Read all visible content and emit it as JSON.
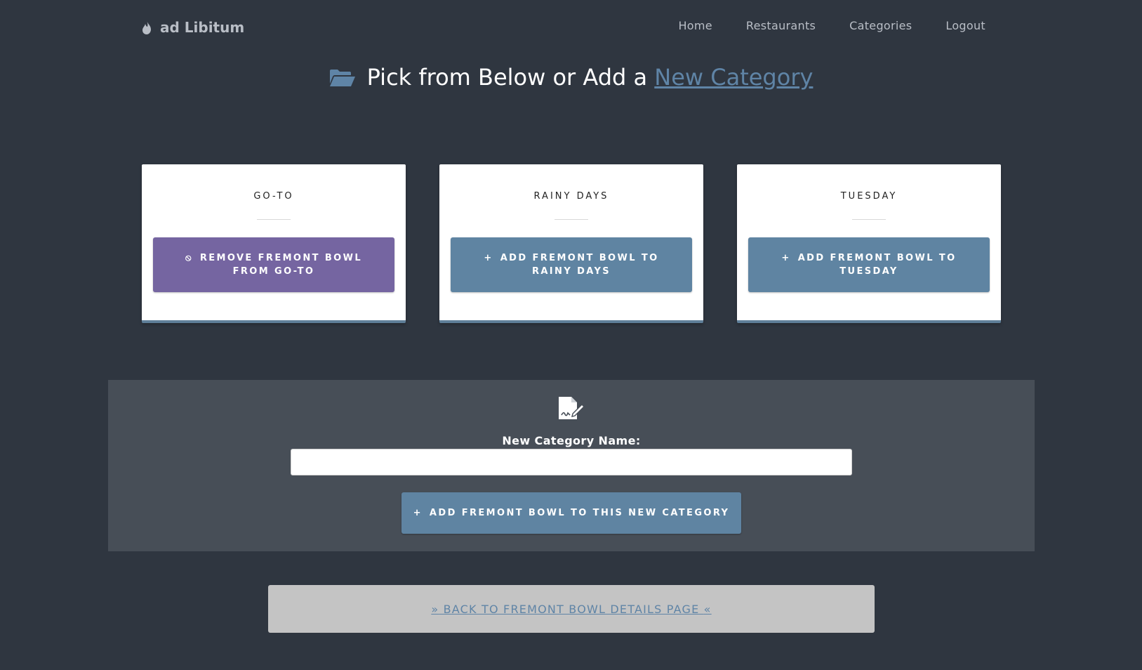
{
  "nav": {
    "brand": "ad Libitum",
    "links": [
      "Home",
      "Restaurants",
      "Categories",
      "Logout"
    ]
  },
  "heading": {
    "text": "Pick from Below or Add a ",
    "link_text": "New Category"
  },
  "cards": [
    {
      "title": "GO-TO",
      "button_icon": "⦸",
      "button_label": "REMOVE FREMONT BOWL FROM GO-TO"
    },
    {
      "title": "RAINY DAYS",
      "button_icon": "+",
      "button_label": "ADD FREMONT BOWL TO RAINY DAYS"
    },
    {
      "title": "TUESDAY",
      "button_icon": "+",
      "button_label": "ADD FREMONT BOWL TO TUESDAY"
    }
  ],
  "form": {
    "label": "New Category Name:",
    "input_value": "",
    "submit_icon": "+",
    "submit_label": "ADD FREMONT BOWL TO THIS NEW CATEGORY"
  },
  "back": {
    "left_glyph": "»",
    "label": " BACK TO FREMONT BOWL DETAILS PAGE ",
    "right_glyph": "«"
  },
  "colors": {
    "background": "#2f3640",
    "panel": "#474e57",
    "accent_blue": "#5f84a2",
    "accent_purple": "#7565a1",
    "back_bar": "#c4c4c4"
  },
  "icons": {
    "brand": "flame-icon",
    "heading": "folder-open-icon",
    "form": "file-signature-icon",
    "remove": "ban-icon",
    "add": "plus-icon"
  }
}
